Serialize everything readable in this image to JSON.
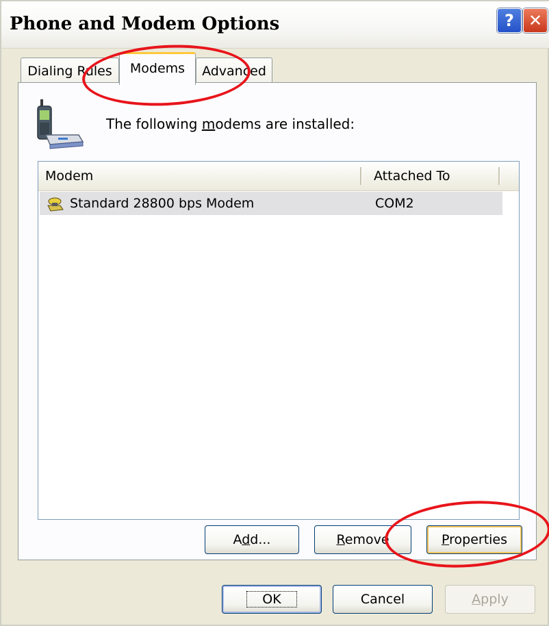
{
  "window": {
    "title": "Phone and Modem Options",
    "help_label": "?",
    "close_label": "✕"
  },
  "tabs": [
    {
      "label": "Dialing Rules",
      "selected": false
    },
    {
      "label": "Modems",
      "selected": true
    },
    {
      "label": "Advanced",
      "selected": false
    }
  ],
  "panel": {
    "info_prefix": "The following ",
    "info_accel": "m",
    "info_suffix": "odems are  installed:",
    "icon": "phone-modem-icon"
  },
  "table": {
    "columns": [
      "Modem",
      "Attached To"
    ],
    "rows": [
      {
        "name": "Standard 28800 bps Modem",
        "port": "COM2",
        "icon": "modem-icon",
        "selected": true
      }
    ]
  },
  "buttons": {
    "add_pre": "A",
    "add_accel": "d",
    "add_post": "d...",
    "remove_pre": "",
    "remove_accel": "R",
    "remove_post": "emove",
    "properties_pre": "",
    "properties_accel": "P",
    "properties_post": "roperties",
    "ok": "OK",
    "cancel": "Cancel",
    "apply_pre": "",
    "apply_accel": "A",
    "apply_post": "pply"
  },
  "colors": {
    "annotation": "#e8141b",
    "window_bg": "#ece9d8",
    "selection": "#e1e1e3",
    "tab_highlight": "#ffc83c"
  }
}
